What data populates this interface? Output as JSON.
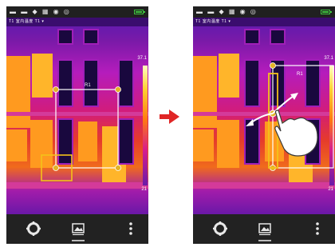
{
  "status_bar": {
    "icons": "▬ ▬ ◆ ▦ ◉ ◎",
    "battery_level": 0.8
  },
  "thermal_view": {
    "header_text": "T1 室内温度 T1 ▾",
    "roi_label": "R1"
  },
  "temperature_scale": {
    "max": "37.1",
    "min": "21"
  },
  "navigation": {
    "settings_icon": "gear-icon",
    "gallery_icon": "gallery-icon",
    "more_icon": "more-vertical-icon"
  },
  "colors": {
    "roi_frame": "#ffffff",
    "roi_handle": "#e3b325",
    "highlight": "#f3c21a",
    "arrow": "#e02626"
  }
}
